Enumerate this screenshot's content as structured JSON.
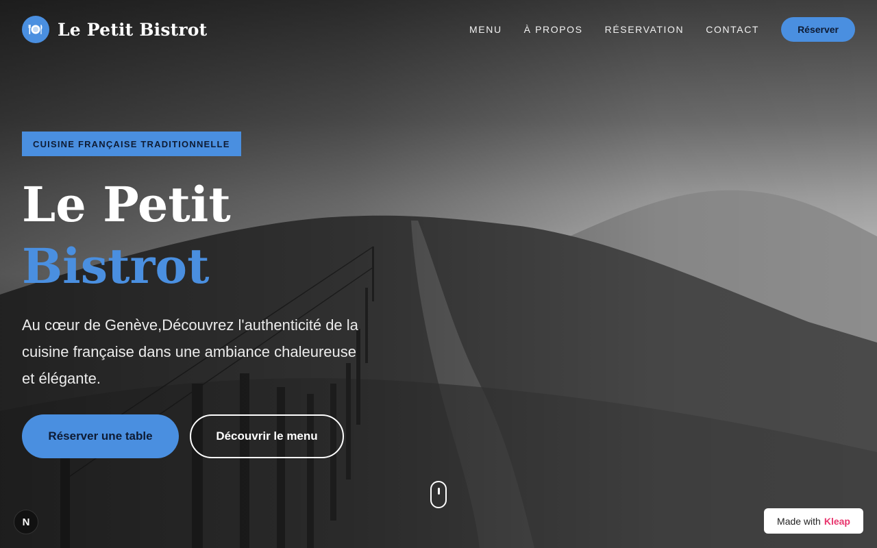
{
  "header": {
    "brand_name": "Le Petit Bistrot",
    "logo_icon": "plate-cutlery-icon",
    "nav": [
      {
        "label": "MENU"
      },
      {
        "label": "À PROPOS"
      },
      {
        "label": "RÉSERVATION"
      },
      {
        "label": "CONTACT"
      }
    ],
    "cta_label": "Réserver"
  },
  "hero": {
    "badge": "CUISINE FRANÇAISE TRADITIONNELLE",
    "title_line1": "Le Petit",
    "title_line2": "Bistrot",
    "description": "Au cœur de Genève,Découvrez l'authenticité de la cuisine française dans une ambiance chaleureuse et élégante.",
    "primary_button": "Réserver une table",
    "secondary_button": "Découvrir le menu",
    "scroll_icon": "mouse-scroll-icon"
  },
  "widgets": {
    "dev_badge": "N",
    "made_with_prefix": "Made with",
    "made_with_brand": "Kleap"
  },
  "colors": {
    "accent": "#4a8fe0",
    "kleap": "#e8356d"
  }
}
